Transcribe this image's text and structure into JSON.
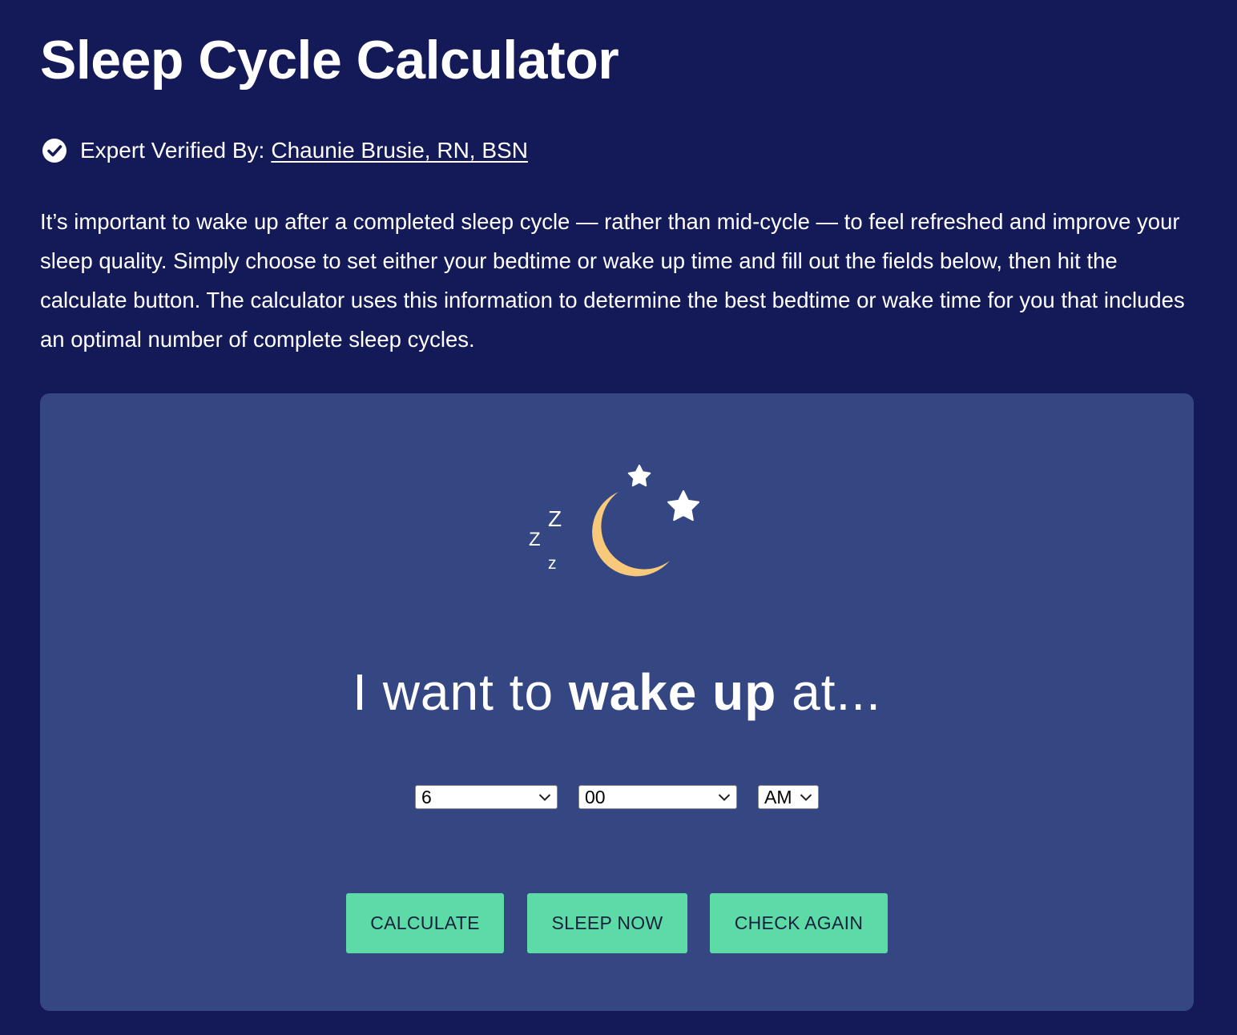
{
  "header": {
    "title": "Sleep Cycle Calculator",
    "verified_label": "Expert Verified By:",
    "verified_author": "Chaunie Brusie, RN, BSN"
  },
  "intro": {
    "text": "It’s important to wake up after a completed sleep cycle — rather than mid-cycle — to feel refreshed and improve your sleep quality. Simply choose to set either your bedtime or wake up time and fill out the fields below, then hit the calculate button. The calculator uses this information to determine the best bedtime or wake time for you that includes an optimal number of complete sleep cycles."
  },
  "calculator": {
    "illustration": {
      "icons": [
        "moon-icon",
        "star-icon",
        "star-icon",
        "zzz-icon"
      ],
      "zzz_letters": [
        "Z",
        "Z",
        "z"
      ]
    },
    "headline": {
      "prefix": "I want to",
      "emphasis": "wake up",
      "suffix": "at..."
    },
    "hour_select": {
      "value": "6"
    },
    "minute_select": {
      "value": "00"
    },
    "ampm_select": {
      "value": "AM"
    },
    "buttons": {
      "calculate": "CALCULATE",
      "sleep_now": "SLEEP NOW",
      "check_again": "CHECK AGAIN"
    }
  },
  "colors": {
    "page_background": "#141a57",
    "card_background": "#344782",
    "button_background": "#5ddba6",
    "button_text": "#16213e",
    "moon": "#f8c97a",
    "text": "#ffffff"
  }
}
